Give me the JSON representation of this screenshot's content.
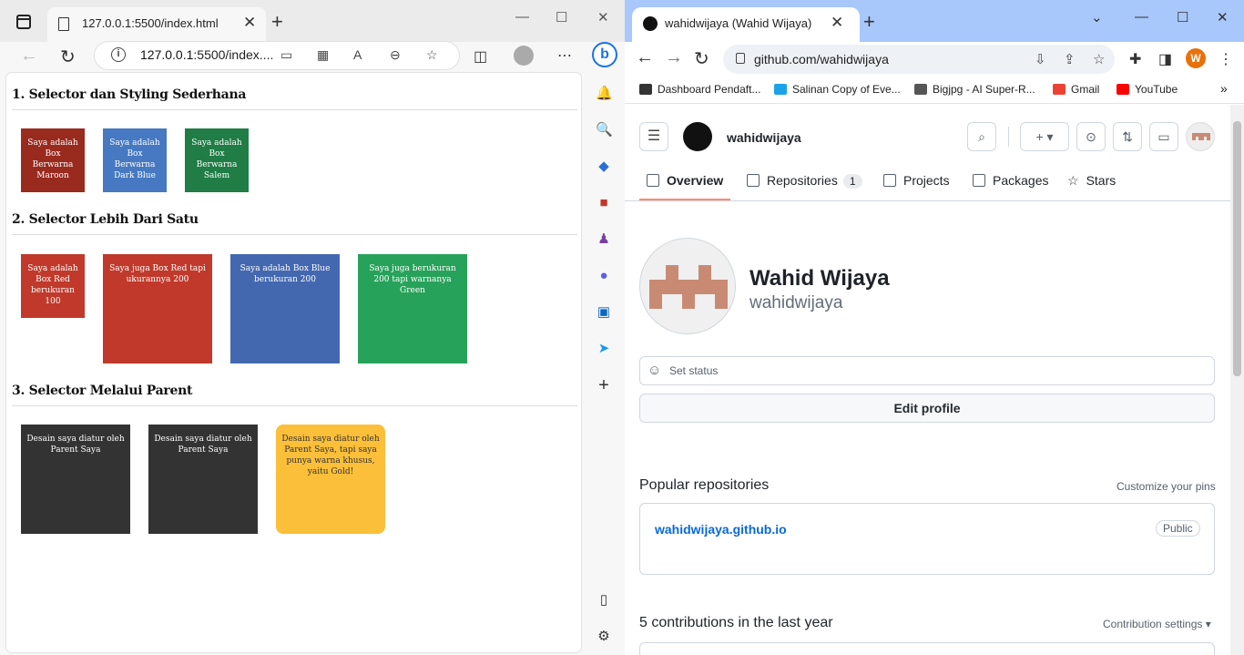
{
  "left_browser": {
    "tab_title": "127.0.0.1:5500/index.html",
    "url_host": "127.0.0.1",
    "url_rest": ":5500/index....",
    "sections": [
      {
        "title": "1. Selector dan Styling Sederhana"
      },
      {
        "title": "2. Selector Lebih Dari Satu"
      },
      {
        "title": "3. Selector Melalui Parent"
      }
    ],
    "boxes_1": [
      {
        "text": "Saya adalah Box Berwarna Maroon",
        "color": "#992a1e"
      },
      {
        "text": "Saya adalah Box Berwarna Dark Blue",
        "color": "#4679c1"
      },
      {
        "text": "Saya adalah Box Berwarna Salem",
        "color": "#1f7d45"
      }
    ],
    "boxes_2": [
      {
        "text": "Saya adalah Box Red berukuran 100",
        "color": "#c0392b"
      },
      {
        "text": "Saya juga Box Red tapi ukurannya 200",
        "color": "#c0392b"
      },
      {
        "text": "Saya adalah Box Blue berukuran 200",
        "color": "#4468b0"
      },
      {
        "text": "Saya juga berukuran 200 tapi warnanya Green",
        "color": "#27a25a"
      }
    ],
    "boxes_3": [
      {
        "text": "Desain saya diatur oleh Parent Saya",
        "color": "#333333"
      },
      {
        "text": "Desain saya diatur oleh Parent Saya",
        "color": "#333333"
      },
      {
        "text": "Desain saya diatur oleh Parent Saya, tapi saya punya warna khusus, yaitu Gold!",
        "color": "#fbbf3a"
      }
    ]
  },
  "right_browser": {
    "tab_title": "wahidwijaya (Wahid Wijaya)",
    "url": "github.com/wahidwijaya",
    "avatar_letter": "W",
    "bookmarks": [
      {
        "label": "Dashboard Pendaft...",
        "color": "#333333"
      },
      {
        "label": "Salinan Copy of Eve...",
        "color": "#1aa3e8"
      },
      {
        "label": "Bigjpg - AI Super-R...",
        "color": "#555555"
      },
      {
        "label": "Gmail",
        "color": "#ea4335"
      },
      {
        "label": "YouTube",
        "color": "#ff0000"
      }
    ],
    "github": {
      "username_header": "wahidwijaya",
      "tabs": [
        {
          "label": "Overview"
        },
        {
          "label": "Repositories",
          "count": "1"
        },
        {
          "label": "Projects"
        },
        {
          "label": "Packages"
        },
        {
          "label": "Stars"
        }
      ],
      "display_name": "Wahid Wijaya",
      "username": "wahidwijaya",
      "set_status": "Set status",
      "edit_profile": "Edit profile",
      "popular_title": "Popular repositories",
      "customize_pins": "Customize your pins",
      "repo_name": "wahidwijaya.github.io",
      "repo_visibility": "Public",
      "contributions_title": "5 contributions in the last year",
      "contribution_settings": "Contribution settings",
      "identicon_color": "#c98a74"
    }
  }
}
